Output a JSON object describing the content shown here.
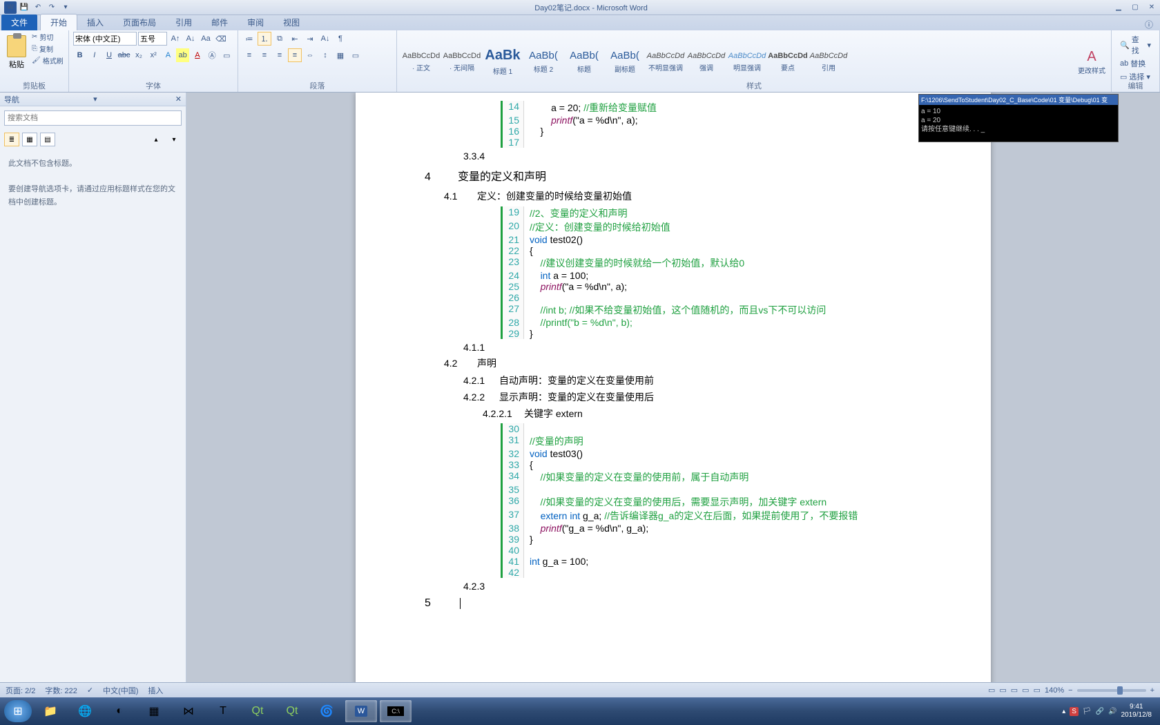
{
  "app": {
    "title": "Day02笔记.docx  -  Microsoft Word"
  },
  "tabs": {
    "file": "文件",
    "items": [
      "开始",
      "插入",
      "页面布局",
      "引用",
      "邮件",
      "审阅",
      "视图"
    ],
    "active": 0
  },
  "clipboard": {
    "paste": "粘贴",
    "cut": "剪切",
    "copy": "复制",
    "brush": "格式刷",
    "label": "剪贴板"
  },
  "font": {
    "name": "宋体 (中文正)",
    "size": "五号",
    "label": "字体"
  },
  "paragraph": {
    "label": "段落"
  },
  "styles": {
    "label": "样式",
    "change": "更改样式",
    "items": [
      {
        "preview": "AaBbCcDd",
        "name": "· 正文"
      },
      {
        "preview": "AaBbCcDd",
        "name": "· 无间隔"
      },
      {
        "preview": "AaBk",
        "name": "标题 1",
        "big": true
      },
      {
        "preview": "AaBb(",
        "name": "标题 2",
        "mid": true
      },
      {
        "preview": "AaBb(",
        "name": "标题",
        "mid": true
      },
      {
        "preview": "AaBb(",
        "name": "副标题",
        "mid": true
      },
      {
        "preview": "AaBbCcDd",
        "name": "不明显强调",
        "italic": true
      },
      {
        "preview": "AaBbCcDd",
        "name": "强调",
        "italic": true
      },
      {
        "preview": "AaBbCcDd",
        "name": "明显强调",
        "italic": true,
        "accent": true
      },
      {
        "preview": "AaBbCcDd",
        "name": "要点",
        "bold": true
      },
      {
        "preview": "AaBbCcDd",
        "name": "引用",
        "italic": true
      }
    ]
  },
  "editing": {
    "find": "查找",
    "replace": "替换",
    "select": "选择",
    "label": "编辑"
  },
  "nav": {
    "title": "导航",
    "placeholder": "搜索文档",
    "empty1": "此文档不包含标题。",
    "empty2": "要创建导航选项卡，请通过应用标题样式在您的文档中创建标题。"
  },
  "console": {
    "title": "F:\\1206\\SendToStudent\\Day02_C_Base\\Code\\01 变量\\Debug\\01 变",
    "l1": "a = 10",
    "l2": "a = 20",
    "l3": "请按任意键继续. . . _"
  },
  "doc": {
    "s334": "3.3.4",
    "s4": "4",
    "s4t": "变量的定义和声明",
    "s41": "4.1",
    "s41t": "定义：创建变量的时候给变量初始值",
    "s411": "4.1.1",
    "s42": "4.2",
    "s42t": "声明",
    "s421": "4.2.1",
    "s421t": "自动声明：变量的定义在变量使用前",
    "s422": "4.2.2",
    "s422t": "显示声明：变量的定义在变量使用后",
    "s4221": "4.2.2.1",
    "s4221t": "关键字  extern",
    "s423": "4.2.3",
    "s5": "5"
  },
  "code1": {
    "l14": "        a = 20; //重新给变量赋值",
    "l15a": "        ",
    "l15fn": "printf",
    "l15b": "(\"a = %d\\n\", a);",
    "l16": "    }",
    "l17": ""
  },
  "code2": {
    "l19": "//2、变量的定义和声明",
    "l20": "//定义：创建变量的时候给初始值",
    "l21a": "void",
    "l21b": " test02()",
    "l22": "{",
    "l23": "    //建议创建变量的时候就给一个初始值，默认给0",
    "l24a": "    ",
    "l24b": "int",
    "l24c": " a = 100;",
    "l25a": "    ",
    "l25fn": "printf",
    "l25b": "(\"a = %d\\n\", a);",
    "l26": "",
    "l27": "    //int b; //如果不给变量初始值，这个值随机的，而且vs下不可以访问",
    "l28": "    //printf(\"b = %d\\n\", b);",
    "l29": "}"
  },
  "code3": {
    "l30": "",
    "l31": "//变量的声明",
    "l32a": "void",
    "l32b": " test03()",
    "l33": "{",
    "l34": "    //如果变量的定义在变量的使用前，属于自动声明",
    "l35": "",
    "l36": "    //如果变量的定义在变量的使用后，需要显示声明，加关键字 extern",
    "l37a": "    ",
    "l37b": "extern int",
    "l37c": " g_a; ",
    "l37d": "//告诉编译器g_a的定义在后面，如果提前使用了，不要报错",
    "l38a": "    ",
    "l38fn": "printf",
    "l38b": "(\"g_a = %d\\n\", g_a);",
    "l39": "}",
    "l40": "",
    "l41a": "int",
    "l41b": " g_a = 100;",
    "l42": ""
  },
  "status": {
    "page": "页面: 2/2",
    "words": "字数: 222",
    "lang": "中文(中国)",
    "mode": "插入",
    "zoom": "140%"
  },
  "taskbar": {
    "time": "9:41",
    "date": "2019/12/8"
  }
}
